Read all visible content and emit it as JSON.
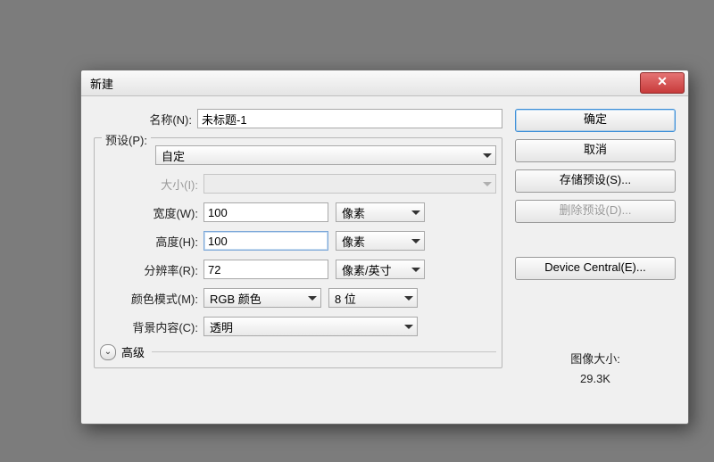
{
  "title": "新建",
  "labels": {
    "name": "名称(N):",
    "preset": "预设(P):",
    "size": "大小(I):",
    "width": "宽度(W):",
    "height": "高度(H):",
    "resolution": "分辨率(R):",
    "colormode": "颜色模式(M):",
    "background": "背景内容(C):",
    "advanced": "高级"
  },
  "fields": {
    "name": "未标题-1",
    "preset": "自定",
    "size": "",
    "width": "100",
    "width_unit": "像素",
    "height": "100",
    "height_unit": "像素",
    "resolution": "72",
    "resolution_unit": "像素/英寸",
    "colormode": "RGB 颜色",
    "bitdepth": "8 位",
    "background": "透明"
  },
  "buttons": {
    "ok": "确定",
    "cancel": "取消",
    "save_preset": "存储预设(S)...",
    "delete_preset": "删除预设(D)...",
    "device_central": "Device Central(E)..."
  },
  "image_size": {
    "label": "图像大小:",
    "value": "29.3K"
  },
  "close_glyph": "✕"
}
